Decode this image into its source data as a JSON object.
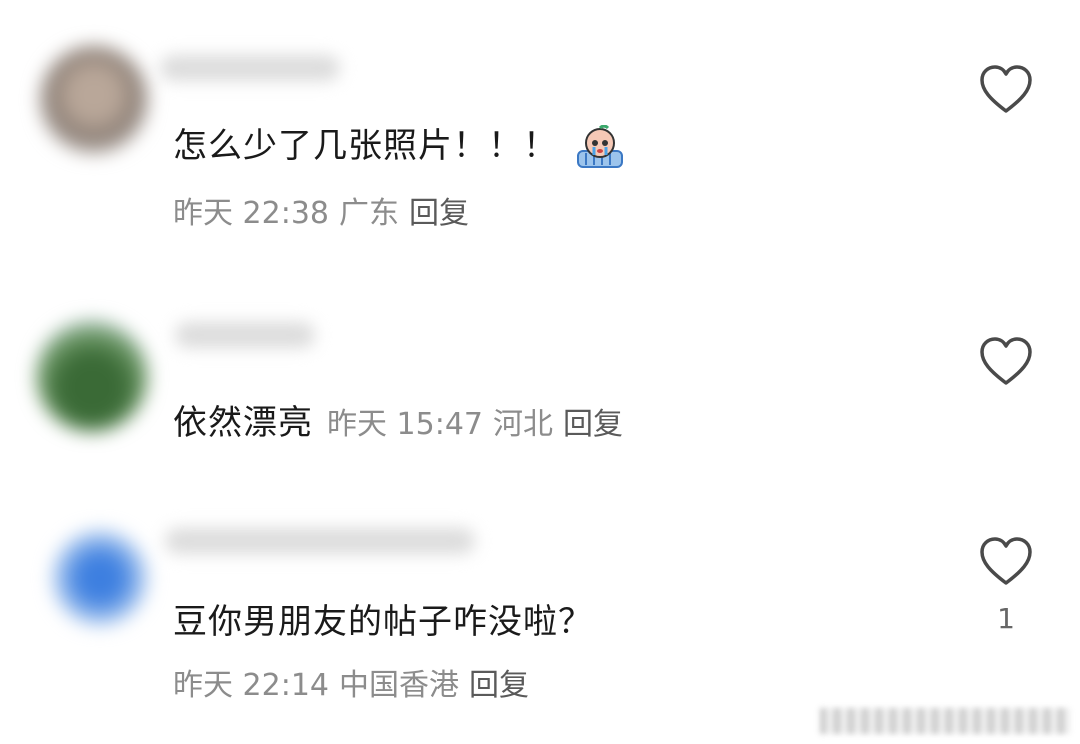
{
  "comments": [
    {
      "text": "怎么少了几张照片！！！",
      "emoji": "crying-emoji",
      "time": "昨天 22:38",
      "location": "广东",
      "reply_label": "回复",
      "like_count": ""
    },
    {
      "text": "依然漂亮",
      "time": "昨天 15:47",
      "location": "河北",
      "reply_label": "回复",
      "like_count": ""
    },
    {
      "text": "豆你男朋友的帖子咋没啦？",
      "time": "昨天 22:14",
      "location": "中国香港",
      "reply_label": "回复",
      "like_count": "1"
    }
  ],
  "colors": {
    "text": "#1a1a1a",
    "meta": "#8c8c8c",
    "reply": "#5a5a5a",
    "heart_stroke": "#4a4a4a"
  },
  "icons": {
    "like": "heart-outline-icon"
  }
}
